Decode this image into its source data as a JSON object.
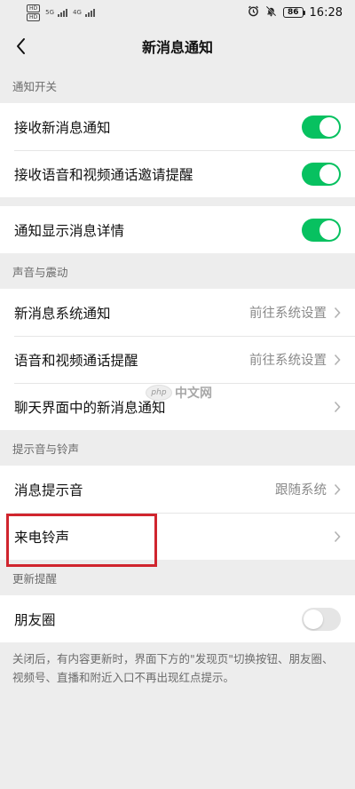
{
  "status_bar": {
    "sim1": "HD",
    "sim2": "HD",
    "net1": "5G",
    "net2": "4G",
    "battery": "86",
    "time": "16:28",
    "alarm_icon": "alarm-icon",
    "mute_icon": "bell-off-icon"
  },
  "nav": {
    "title": "新消息通知",
    "back_icon": "chevron-left-icon"
  },
  "sections": {
    "notify_switch": {
      "header": "通知开关",
      "receive_new": {
        "label": "接收新消息通知",
        "on": true
      },
      "receive_call": {
        "label": "接收语音和视频通话邀请提醒",
        "on": true
      },
      "show_detail": {
        "label": "通知显示消息详情",
        "on": true
      }
    },
    "sound_vibrate": {
      "header": "声音与震动",
      "system_notify": {
        "label": "新消息系统通知",
        "value": "前往系统设置"
      },
      "call_alert": {
        "label": "语音和视频通话提醒",
        "value": "前往系统设置"
      },
      "chat_notify": {
        "label": "聊天界面中的新消息通知"
      }
    },
    "tone_ringtone": {
      "header": "提示音与铃声",
      "message_tone": {
        "label": "消息提示音",
        "value": "跟随系统"
      },
      "ringtone": {
        "label": "来电铃声"
      }
    },
    "update_alert": {
      "header": "更新提醒",
      "moments": {
        "label": "朋友圈",
        "on": false
      },
      "footnote": "关闭后，有内容更新时，界面下方的\"发现页\"切换按钮、朋友圈、视频号、直播和附近入口不再出现红点提示。"
    }
  },
  "watermark": {
    "badge": "php",
    "text": "中文网"
  },
  "colors": {
    "toggle_on": "#07c160",
    "toggle_off": "#e5e5e5",
    "highlight": "#d0252e",
    "background": "#ededed"
  }
}
